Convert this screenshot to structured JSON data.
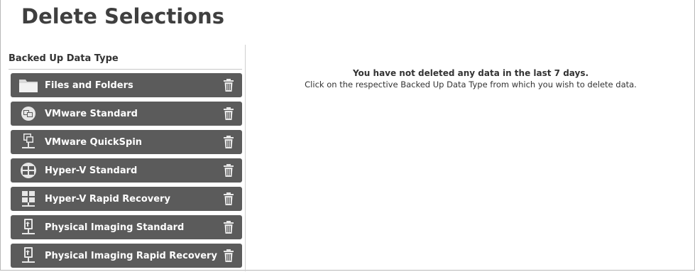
{
  "page": {
    "title": "Delete Selections"
  },
  "sidebar": {
    "header": "Backed Up Data Type",
    "items": [
      {
        "label": "Files and Folders",
        "icon": "folder-icon"
      },
      {
        "label": "VMware Standard",
        "icon": "vmware-icon"
      },
      {
        "label": "VMware QuickSpin",
        "icon": "quickspin-icon"
      },
      {
        "label": "Hyper-V Standard",
        "icon": "hyperv-icon"
      },
      {
        "label": "Hyper-V Rapid Recovery",
        "icon": "hyperv-rapid-icon"
      },
      {
        "label": "Physical Imaging Standard",
        "icon": "physical-imaging-icon"
      },
      {
        "label": "Physical Imaging Rapid Recovery",
        "icon": "physical-imaging-rapid-icon"
      }
    ],
    "delete_icon": "trash-icon"
  },
  "main": {
    "message": "You have not deleted any data in the last 7 days.",
    "instruction": "Click on the respective Backed Up Data Type from which you wish to delete data."
  },
  "colors": {
    "item_background": "#5b5b5b",
    "item_text": "#ffffff",
    "title_text": "#3f3f3f"
  }
}
